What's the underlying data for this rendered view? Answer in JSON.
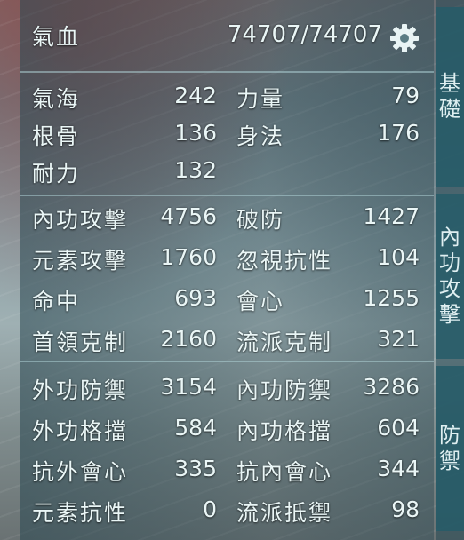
{
  "header": {
    "hp_label": "氣血",
    "hp_value": "74707/74707",
    "settings_icon": "gear-icon"
  },
  "tabs": [
    {
      "label_lines": [
        "基",
        "礎"
      ]
    },
    {
      "label_lines": [
        "內",
        "功",
        "攻",
        "擊"
      ]
    },
    {
      "label_lines": [
        "防",
        "禦"
      ]
    }
  ],
  "sections": [
    {
      "rows": [
        {
          "left": {
            "label": "氣海",
            "value": "242"
          },
          "right": {
            "label": "力量",
            "value": "79"
          }
        },
        {
          "left": {
            "label": "根骨",
            "value": "136"
          },
          "right": {
            "label": "身法",
            "value": "176"
          }
        },
        {
          "left": {
            "label": "耐力",
            "value": "132"
          }
        }
      ]
    },
    {
      "rows": [
        {
          "left": {
            "label": "內功攻擊",
            "value": "4756"
          },
          "right": {
            "label": "破防",
            "value": "1427"
          }
        },
        {
          "left": {
            "label": "元素攻擊",
            "value": "1760"
          },
          "right": {
            "label": "忽視抗性",
            "value": "104"
          }
        },
        {
          "left": {
            "label": "命中",
            "value": "693"
          },
          "right": {
            "label": "會心",
            "value": "1255"
          }
        },
        {
          "left": {
            "label": "首領克制",
            "value": "2160"
          },
          "right": {
            "label": "流派克制",
            "value": "321"
          }
        }
      ]
    },
    {
      "rows": [
        {
          "left": {
            "label": "外功防禦",
            "value": "3154"
          },
          "right": {
            "label": "內功防禦",
            "value": "3286"
          }
        },
        {
          "left": {
            "label": "外功格擋",
            "value": "584"
          },
          "right": {
            "label": "內功格擋",
            "value": "604"
          }
        },
        {
          "left": {
            "label": "抗外會心",
            "value": "335"
          },
          "right": {
            "label": "抗內會心",
            "value": "344"
          }
        },
        {
          "left": {
            "label": "元素抗性",
            "value": "0"
          },
          "right": {
            "label": "流派抵禦",
            "value": "98"
          }
        }
      ]
    }
  ]
}
